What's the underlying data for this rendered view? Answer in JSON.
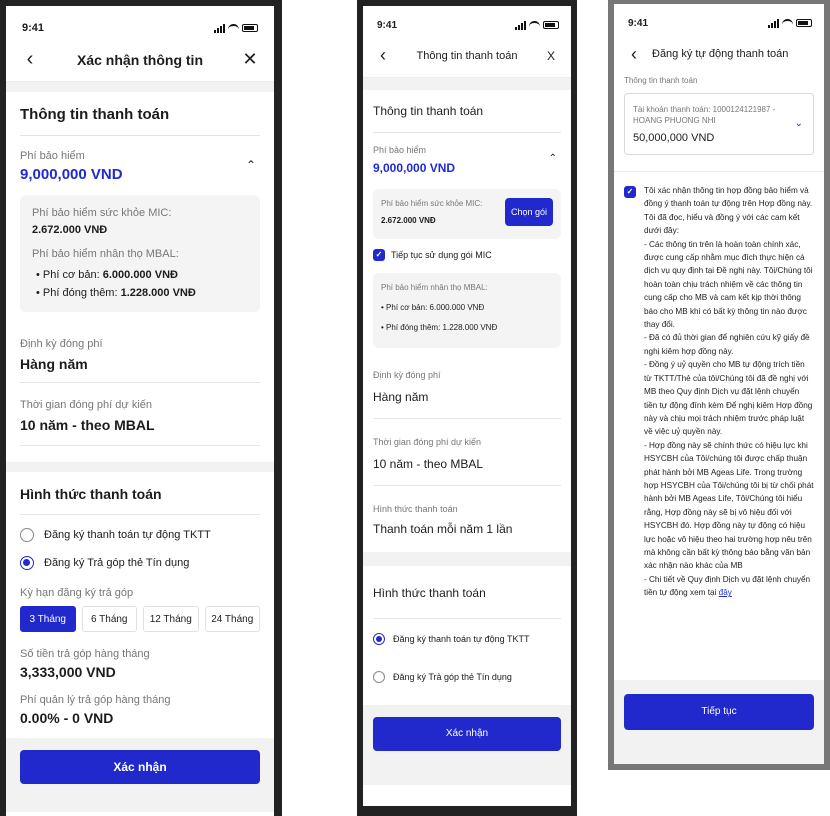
{
  "status_time": "9:41",
  "screen1": {
    "nav_title": "Xác nhận thông tin",
    "payment_info_title": "Thông tin thanh toán",
    "premium_label": "Phí bảo hiểm",
    "premium_value": "9,000,000 VND",
    "mic_label": "Phí bảo hiểm sức khỏe MIC:",
    "mic_value": "2.672.000 VNĐ",
    "mbal_label": "Phí bảo hiểm nhân thọ MBAL:",
    "mbal_items": [
      {
        "label": "Phí cơ bản: ",
        "value": "6.000.000 VNĐ"
      },
      {
        "label": "Phí đóng thêm: ",
        "value": "1.228.000 VNĐ"
      }
    ],
    "period_label": "Định kỳ đóng phí",
    "period_value": "Hàng năm",
    "term_label": "Thời gian đóng phí dự kiến",
    "term_value": "10 năm - theo MBAL",
    "method_title": "Hình thức thanh toán",
    "option_auto": "Đăng ký thanh toán tự động TKTT",
    "option_installment": "Đăng ký Trả góp thẻ Tín dụng",
    "installment_term_label": "Kỳ hạn đăng ký trả góp",
    "terms": [
      "3 Tháng",
      "6 Tháng",
      "12 Tháng",
      "24 Tháng"
    ],
    "monthly_label": "Số tiền trả góp hàng tháng",
    "monthly_value": "3,333,000 VND",
    "fee_label": "Phí quản lý trả góp hàng tháng",
    "fee_value": "0.00% - 0 VND",
    "confirm_button": "Xác nhận"
  },
  "screen2": {
    "nav_title": "Thông tin thanh toán",
    "close_glyph": "X",
    "payment_info_title": "Thông tin thanh toán",
    "premium_label": "Phí bảo hiểm",
    "premium_value": "9,000,000 VND",
    "mic_label": "Phí bảo hiểm sức khỏe MIC:",
    "mic_value": "2.672.000 VNĐ",
    "choose_package_button": "Chọn gói",
    "continue_mic_label": "Tiếp tục sử dụng gói MIC",
    "mbal_label": "Phí bảo hiểm nhân thọ MBAL:",
    "mbal_items": [
      {
        "label": "Phí cơ bản: ",
        "value": "6.000.000 VNĐ"
      },
      {
        "label": "Phí đóng thêm: ",
        "value": "1.228.000 VNĐ"
      }
    ],
    "period_label": "Định kỳ đóng phí",
    "period_value": "Hàng năm",
    "term_label": "Thời gian đóng phí dự kiến",
    "term_value": "10 năm - theo MBAL",
    "form_label": "Hình thức thanh toán",
    "form_value": "Thanh toán mỗi năm 1 lần",
    "method_title": "Hình thức thanh toán",
    "option_auto": "Đăng ký thanh toán tự động TKTT",
    "option_installment": "Đăng ký Trả góp thẻ Tín dụng",
    "confirm_button": "Xác nhận"
  },
  "screen3": {
    "nav_title": "Đăng ký tự động thanh toán",
    "section_label": "Thông tin thanh toán",
    "account_label": "Tài khoản thanh toán: 1000124121987 - HOANG PHUONG NHI",
    "account_balance": "50,000,000 VND",
    "agreement_paragraphs": [
      "Tôi xác nhận thông tin hợp đồng bảo hiểm và đồng ý thanh toán tự động trên Hợp đồng này. Tôi đã đọc, hiểu và đồng ý với các cam kết dưới đây:",
      "- Các thông tin trên là hoàn toàn chính xác, được cung cấp nhằm mục đích thực hiện cá dịch vụ quy định tại Đề nghị này. Tôi/Chúng tôi hoàn toàn chịu trách nhiệm về các thông tin cung cấp cho MB và cam kết kịp thời thông báo cho MB khi có bất kỳ thông tin nào được thay đổi.",
      "- Đã có đủ thời gian để nghiên cứu kỹ giấy đề nghị kiêm hợp đồng này.",
      "- Đồng ý uỷ quyền cho MB tự động trích tiền từ TKTT/Thẻ của tôi/Chúng tôi đã đề nghị với MB theo Quy định Dịch vụ đặt lệnh chuyển tiền tự động đính kèm Để nghị kiêm Hợp đồng này và chịu mọi trách nhiệm trước pháp luật về việc uỷ quyền này.",
      "- Hợp đồng này sẽ chính thức có hiệu lực khi HSYCBH của Tôi/chúng tôi được chấp thuận phát hành bởi MB Ageas Life. Trong trường hợp HSYCBH của Tôi/chúng tôi bị từ chối phát hành bởi MB Ageas Life, Tôi/Chúng tôi hiểu rằng, Hợp đồng này sẽ bị vô hiệu đối với HSYCBH đó. Hợp đồng này tự động có hiệu lực hoặc vô hiệu theo hai trường hợp nêu trên mà không cần bất kỳ thông báo bằng văn bản xác nhận nào khác của MB"
    ],
    "last_line_text": "- Chi tiết về Quy định Dịch vụ đặt lệnh chuyển tiền tự động xem tại ",
    "last_line_link": "đây",
    "continue_button": "Tiếp tục"
  },
  "colors": {
    "primary": "#2129cc",
    "price": "#1f2bd0"
  }
}
